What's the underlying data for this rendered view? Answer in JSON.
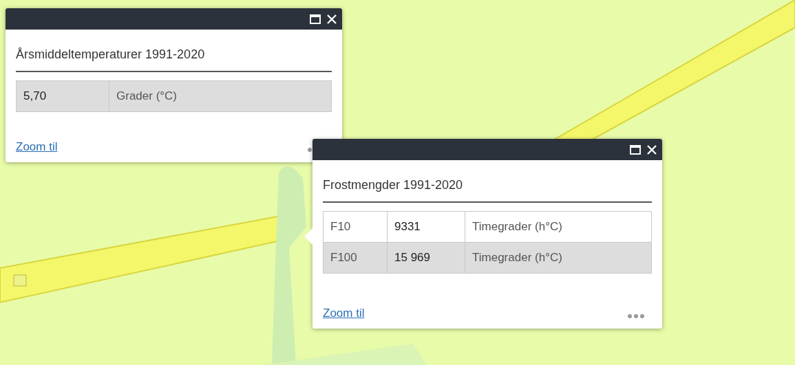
{
  "popups": [
    {
      "title": "Årsmiddeltemperaturer 1991-2020",
      "rows": [
        [
          "5,70",
          "Grader (°C)"
        ]
      ],
      "link": "Zoom til",
      "pointer": false
    },
    {
      "title": "Frostmengder 1991-2020",
      "rows": [
        [
          "F10",
          "9331",
          "Timegrader (h°C)"
        ],
        [
          "F100",
          "15 969",
          "Timegrader (h°C)"
        ]
      ],
      "link": "Zoom til",
      "pointer": true
    }
  ]
}
